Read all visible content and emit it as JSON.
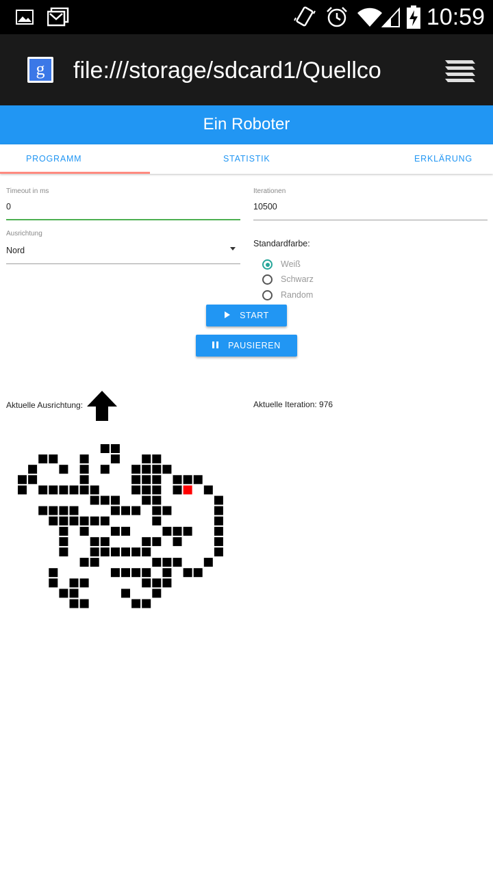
{
  "status_bar": {
    "time": "10:59",
    "icons": [
      "image-icon",
      "gmail-icon",
      "vibrate-icon",
      "alarm-icon",
      "wifi-icon",
      "signal-icon",
      "battery-charging-icon"
    ]
  },
  "browser": {
    "url": "file:///storage/sdcard1/Quellco",
    "site_icon": "g",
    "menu_icon": "stack-menu-icon"
  },
  "app": {
    "title": "Ein Roboter"
  },
  "tabs": [
    {
      "label": "PROGRAMM",
      "active": true
    },
    {
      "label": "STATISTIK",
      "active": false
    },
    {
      "label": "ERKLÄRUNG",
      "active": false
    }
  ],
  "form": {
    "timeout_label": "Timeout in ms",
    "timeout_value": "0",
    "iterations_label": "Iterationen",
    "iterations_value": "10500",
    "direction_label": "Ausrichtung",
    "direction_value": "Nord",
    "color_label": "Standardfarbe:",
    "color_options": [
      {
        "label": "Weiß",
        "checked": true
      },
      {
        "label": "Schwarz",
        "checked": false
      },
      {
        "label": "Random",
        "checked": false
      }
    ]
  },
  "buttons": {
    "start": "START",
    "pause": "PAUSIEREN"
  },
  "info": {
    "direction_label": "Aktuelle Ausrichtung:",
    "direction_arrow": "up-arrow-icon",
    "iteration_label": "Aktuelle Iteration: 976"
  },
  "colors": {
    "primary": "#2196f3",
    "tab_indicator": "#ff8a80",
    "active_underline": "#4caf50",
    "radio_checked": "#26a69a",
    "robot_cell": "#ff0000",
    "black_cell": "#000000"
  },
  "robot_grid": {
    "black_cells": [
      [
        0,
        8
      ],
      [
        0,
        9
      ],
      [
        1,
        2
      ],
      [
        1,
        3
      ],
      [
        1,
        6
      ],
      [
        1,
        9
      ],
      [
        1,
        12
      ],
      [
        1,
        13
      ],
      [
        2,
        1
      ],
      [
        2,
        4
      ],
      [
        2,
        6
      ],
      [
        2,
        8
      ],
      [
        2,
        11
      ],
      [
        2,
        12
      ],
      [
        2,
        13
      ],
      [
        2,
        14
      ],
      [
        3,
        0
      ],
      [
        3,
        1
      ],
      [
        3,
        6
      ],
      [
        3,
        11
      ],
      [
        3,
        12
      ],
      [
        3,
        13
      ],
      [
        3,
        15
      ],
      [
        3,
        16
      ],
      [
        3,
        17
      ],
      [
        4,
        0
      ],
      [
        4,
        2
      ],
      [
        4,
        3
      ],
      [
        4,
        4
      ],
      [
        4,
        5
      ],
      [
        4,
        6
      ],
      [
        4,
        7
      ],
      [
        4,
        11
      ],
      [
        4,
        12
      ],
      [
        4,
        13
      ],
      [
        4,
        15
      ],
      [
        4,
        18
      ],
      [
        5,
        7
      ],
      [
        5,
        8
      ],
      [
        5,
        9
      ],
      [
        5,
        12
      ],
      [
        5,
        13
      ],
      [
        5,
        19
      ],
      [
        6,
        2
      ],
      [
        6,
        3
      ],
      [
        6,
        4
      ],
      [
        6,
        5
      ],
      [
        6,
        9
      ],
      [
        6,
        10
      ],
      [
        6,
        11
      ],
      [
        6,
        13
      ],
      [
        6,
        14
      ],
      [
        6,
        19
      ],
      [
        7,
        3
      ],
      [
        7,
        4
      ],
      [
        7,
        5
      ],
      [
        7,
        6
      ],
      [
        7,
        7
      ],
      [
        7,
        8
      ],
      [
        7,
        13
      ],
      [
        7,
        19
      ],
      [
        8,
        4
      ],
      [
        8,
        6
      ],
      [
        8,
        9
      ],
      [
        8,
        10
      ],
      [
        8,
        14
      ],
      [
        8,
        15
      ],
      [
        8,
        16
      ],
      [
        8,
        19
      ],
      [
        9,
        4
      ],
      [
        9,
        7
      ],
      [
        9,
        8
      ],
      [
        9,
        12
      ],
      [
        9,
        13
      ],
      [
        9,
        15
      ],
      [
        9,
        19
      ],
      [
        10,
        4
      ],
      [
        10,
        7
      ],
      [
        10,
        8
      ],
      [
        10,
        9
      ],
      [
        10,
        10
      ],
      [
        10,
        11
      ],
      [
        10,
        12
      ],
      [
        10,
        19
      ],
      [
        11,
        6
      ],
      [
        11,
        7
      ],
      [
        11,
        13
      ],
      [
        11,
        14
      ],
      [
        11,
        15
      ],
      [
        11,
        18
      ],
      [
        12,
        3
      ],
      [
        12,
        9
      ],
      [
        12,
        10
      ],
      [
        12,
        11
      ],
      [
        12,
        12
      ],
      [
        12,
        14
      ],
      [
        12,
        16
      ],
      [
        12,
        17
      ],
      [
        13,
        3
      ],
      [
        13,
        5
      ],
      [
        13,
        6
      ],
      [
        13,
        12
      ],
      [
        13,
        13
      ],
      [
        13,
        14
      ],
      [
        14,
        4
      ],
      [
        14,
        5
      ],
      [
        14,
        10
      ],
      [
        14,
        13
      ],
      [
        15,
        5
      ],
      [
        15,
        6
      ],
      [
        15,
        11
      ],
      [
        15,
        12
      ]
    ],
    "robot_cell": [
      4,
      16
    ]
  }
}
